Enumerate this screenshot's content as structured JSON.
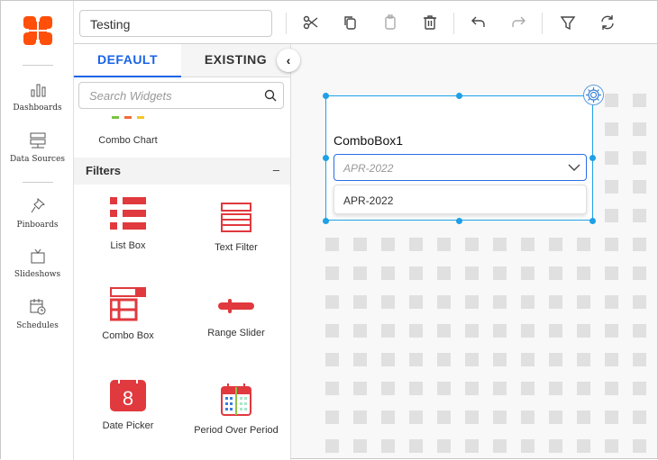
{
  "nav": {
    "items": [
      {
        "label": "Dashboards",
        "icon": "bar-chart-icon"
      },
      {
        "label": "Data Sources",
        "icon": "server-icon"
      },
      {
        "label": "Pinboards",
        "icon": "pin-icon"
      },
      {
        "label": "Slideshows",
        "icon": "tv-icon"
      },
      {
        "label": "Schedules",
        "icon": "calendar-clock-icon"
      }
    ]
  },
  "toolbar": {
    "dashboard_name": "Testing"
  },
  "panel": {
    "tabs": [
      "DEFAULT",
      "EXISTING"
    ],
    "search_placeholder": "Search Widgets",
    "prev_widget": "Combo Chart",
    "category": "Filters",
    "collapse_symbol": "–",
    "widgets": [
      "List Box",
      "Text Filter",
      "Combo Box",
      "Range Slider",
      "Date Picker",
      "Period Over Period"
    ]
  },
  "widget": {
    "title": "ComboBox1",
    "placeholder": "APR-2022",
    "options": [
      "APR-2022"
    ]
  },
  "colors": {
    "accent": "#1a63e6",
    "brand": "#ff4f0a",
    "icon_red": "#e0393e",
    "selection": "#1ea0e6"
  }
}
